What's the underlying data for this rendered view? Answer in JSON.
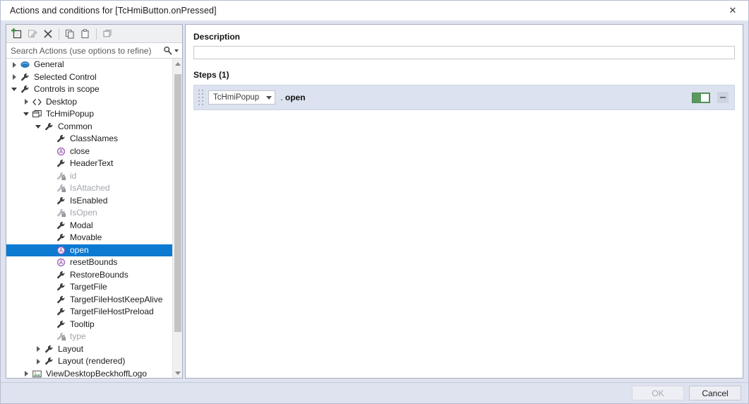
{
  "window": {
    "title": "Actions and conditions for [TcHmiButton.onPressed]",
    "close_label": "✕"
  },
  "left_panel": {
    "toolbar": [
      {
        "name": "new-action-icon",
        "tooltip": "New",
        "enabled": true
      },
      {
        "name": "edit-action-icon",
        "tooltip": "Edit",
        "enabled": false
      },
      {
        "name": "delete-action-icon",
        "tooltip": "Delete",
        "enabled": true
      },
      {
        "name": "copy-icon",
        "tooltip": "Copy",
        "enabled": true
      },
      {
        "name": "paste-icon",
        "tooltip": "Paste",
        "enabled": true
      },
      {
        "name": "group-icon",
        "tooltip": "Options",
        "enabled": true
      }
    ],
    "search": {
      "placeholder": "Search Actions (use options to refine)",
      "value": "",
      "icon": "search-icon",
      "dropdown_icon": "chevron-down-icon"
    },
    "tree": [
      {
        "label": "General",
        "depth": 0,
        "icon": "general-icon",
        "twisty": "closed",
        "dim": false,
        "selected": false
      },
      {
        "label": "Selected Control",
        "depth": 0,
        "icon": "wrench-icon",
        "twisty": "closed",
        "dim": false,
        "selected": false
      },
      {
        "label": "Controls in scope",
        "depth": 0,
        "icon": "wrench-icon",
        "twisty": "open",
        "dim": false,
        "selected": false
      },
      {
        "label": "Desktop",
        "depth": 1,
        "icon": "code-icon",
        "twisty": "closed",
        "dim": false,
        "selected": false
      },
      {
        "label": "TcHmiPopup",
        "depth": 1,
        "icon": "popup-icon",
        "twisty": "open",
        "dim": false,
        "selected": false
      },
      {
        "label": "Common",
        "depth": 2,
        "icon": "wrench-icon",
        "twisty": "open",
        "dim": false,
        "selected": false
      },
      {
        "label": "ClassNames",
        "depth": 3,
        "icon": "wrench-icon",
        "twisty": "none",
        "dim": false,
        "selected": false
      },
      {
        "label": "close",
        "depth": 3,
        "icon": "method-icon",
        "twisty": "none",
        "dim": false,
        "selected": false
      },
      {
        "label": "HeaderText",
        "depth": 3,
        "icon": "wrench-icon",
        "twisty": "none",
        "dim": false,
        "selected": false
      },
      {
        "label": "id",
        "depth": 3,
        "icon": "wrench-lock-icon",
        "twisty": "none",
        "dim": true,
        "selected": false
      },
      {
        "label": "IsAttached",
        "depth": 3,
        "icon": "wrench-lock-icon",
        "twisty": "none",
        "dim": true,
        "selected": false
      },
      {
        "label": "IsEnabled",
        "depth": 3,
        "icon": "wrench-icon",
        "twisty": "none",
        "dim": false,
        "selected": false
      },
      {
        "label": "IsOpen",
        "depth": 3,
        "icon": "wrench-lock-icon",
        "twisty": "none",
        "dim": true,
        "selected": false
      },
      {
        "label": "Modal",
        "depth": 3,
        "icon": "wrench-icon",
        "twisty": "none",
        "dim": false,
        "selected": false
      },
      {
        "label": "Movable",
        "depth": 3,
        "icon": "wrench-icon",
        "twisty": "none",
        "dim": false,
        "selected": false
      },
      {
        "label": "open",
        "depth": 3,
        "icon": "method-icon",
        "twisty": "none",
        "dim": false,
        "selected": true
      },
      {
        "label": "resetBounds",
        "depth": 3,
        "icon": "method-icon",
        "twisty": "none",
        "dim": false,
        "selected": false
      },
      {
        "label": "RestoreBounds",
        "depth": 3,
        "icon": "wrench-icon",
        "twisty": "none",
        "dim": false,
        "selected": false
      },
      {
        "label": "TargetFile",
        "depth": 3,
        "icon": "wrench-icon",
        "twisty": "none",
        "dim": false,
        "selected": false
      },
      {
        "label": "TargetFileHostKeepAlive",
        "depth": 3,
        "icon": "wrench-icon",
        "twisty": "none",
        "dim": false,
        "selected": false
      },
      {
        "label": "TargetFileHostPreload",
        "depth": 3,
        "icon": "wrench-icon",
        "twisty": "none",
        "dim": false,
        "selected": false
      },
      {
        "label": "Tooltip",
        "depth": 3,
        "icon": "wrench-icon",
        "twisty": "none",
        "dim": false,
        "selected": false
      },
      {
        "label": "type",
        "depth": 3,
        "icon": "wrench-lock-icon",
        "twisty": "none",
        "dim": true,
        "selected": false
      },
      {
        "label": "Layout",
        "depth": 2,
        "icon": "wrench-icon",
        "twisty": "closed",
        "dim": false,
        "selected": false
      },
      {
        "label": "Layout (rendered)",
        "depth": 2,
        "icon": "wrench-icon",
        "twisty": "closed",
        "dim": false,
        "selected": false
      },
      {
        "label": "ViewDesktopBeckhoffLogo",
        "depth": 1,
        "icon": "image-icon",
        "twisty": "closed",
        "dim": false,
        "selected": false
      }
    ],
    "scrollbar": {
      "up_icon": "scroll-up-arrow",
      "down_icon": "scroll-down-arrow",
      "thumb_top_pct": 2,
      "thumb_height_pct": 86
    }
  },
  "right_panel": {
    "description_label": "Description",
    "description_value": "",
    "description_placeholder": "",
    "steps_label": "Steps (1)",
    "steps": [
      {
        "target": "TcHmiPopup",
        "separator": ".",
        "method": "open",
        "enabled": true,
        "toggle_icon": "toggle-switch-on",
        "remove_icon": "minus-icon",
        "drag_icon": "drag-handle-icon"
      }
    ]
  },
  "footer": {
    "ok_label": "OK",
    "ok_enabled": false,
    "cancel_label": "Cancel",
    "cancel_enabled": true
  },
  "colors": {
    "selection_blue": "#0c7ad1",
    "toggle_green": "#5a9a5e",
    "dialog_chrome": "#dfe3f0",
    "step_row_bg": "#dce2ef",
    "method_purple": "#9b5fb5"
  }
}
